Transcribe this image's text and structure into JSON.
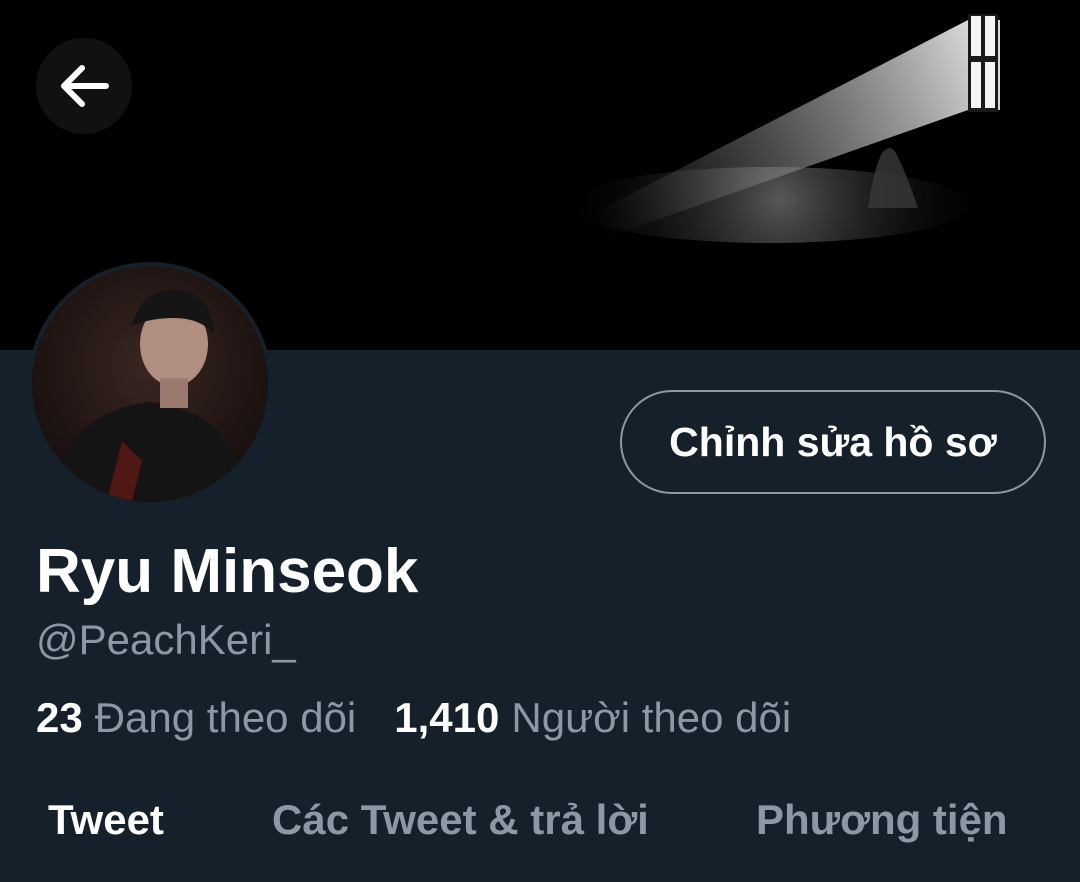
{
  "header": {
    "back_icon": "arrow-left-icon"
  },
  "profile": {
    "edit_button_label": "Chỉnh sửa hồ sơ",
    "display_name": "Ryu Minseok",
    "handle": "@PeachKeri_",
    "following_count": "23",
    "following_label": "Đang theo dõi",
    "followers_count": "1,410",
    "followers_label": "Người theo dõi"
  },
  "tabs": [
    {
      "label": "Tweet",
      "active": true
    },
    {
      "label": "Các Tweet & trả lời",
      "active": false
    },
    {
      "label": "Phương tiện",
      "active": false
    }
  ],
  "colors": {
    "background": "#15202b",
    "banner": "#000000",
    "primary_text": "#ffffff",
    "secondary_text": "#8b98a5",
    "button_border": "#8b98a5"
  }
}
